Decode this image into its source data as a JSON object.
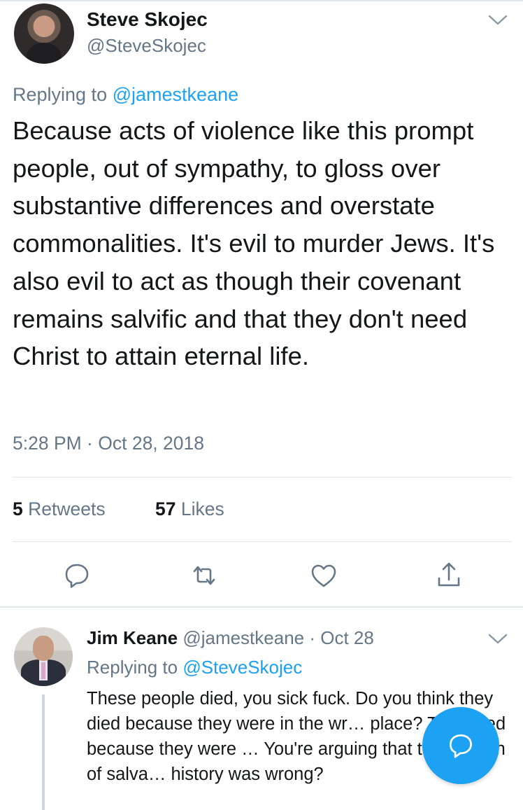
{
  "main_tweet": {
    "author_name": "Steve Skojec",
    "author_handle": "@SteveSkojec",
    "replying_prefix": "Replying to",
    "replying_handle": "@jamestkeane",
    "text": "Because acts of violence like this prompt people, out of sympathy, to gloss over substantive differences and overstate commonalities. It's evil to murder Jews. It's also evil to act as though their covenant remains salvific and that they don't need Christ to attain eternal life.",
    "timestamp": "5:28 PM · Oct 28, 2018",
    "retweets_count": "5",
    "retweets_label": "Retweets",
    "likes_count": "57",
    "likes_label": "Likes",
    "actions": [
      "reply-icon",
      "retweet-icon",
      "like-icon",
      "share-icon"
    ]
  },
  "reply_tweet": {
    "author_name": "Jim Keane",
    "author_handle": "@jamestkeane",
    "date": "Oct 28",
    "replying_prefix": "Replying to",
    "replying_handle": "@SteveSkojec",
    "text": "These people died, you sick fuck. Do you think they died because they were in the wr… place? They died because they were … You're arguing that their notion of salva… history was wrong?"
  },
  "compose_button": {
    "icon": "compose-reply-icon"
  },
  "colors": {
    "accent": "#1da1f2",
    "secondary_text": "#657786",
    "primary_text": "#14171a",
    "divider": "#e1e8ed"
  }
}
